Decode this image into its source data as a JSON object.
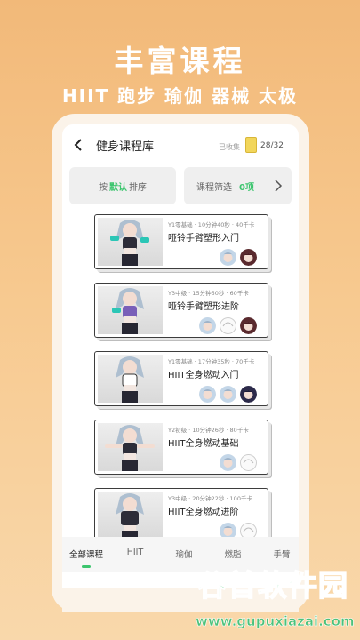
{
  "promo": {
    "title": "丰富课程",
    "subtitle": "HIIT 跑步 瑜伽 器械 太极"
  },
  "header": {
    "title": "健身课程库",
    "collected_label": "已收集",
    "count": "28/32"
  },
  "filters": {
    "sort_prefix": "按",
    "sort_value": "默认",
    "sort_suffix": "排序",
    "filter_label": "课程筛选",
    "filter_count": "0项"
  },
  "courses": [
    {
      "meta": "Y1零基础 · 10分钟40秒 · 40千卡",
      "name": "哑铃手臂塑形入门"
    },
    {
      "meta": "Y3中级 · 15分钟50秒 · 60千卡",
      "name": "哑铃手臂塑形进阶"
    },
    {
      "meta": "Y1零基础 · 17分钟35秒 · 70千卡",
      "name": "HIIT全身燃动入门"
    },
    {
      "meta": "Y2初级 · 10分钟26秒 · 80千卡",
      "name": "HIIT全身燃动基础"
    },
    {
      "meta": "Y3中级 · 20分钟22秒 · 100千卡",
      "name": "HIIT全身燃动进阶"
    }
  ],
  "tabs": [
    "全部课程",
    "HIIT",
    "瑜伽",
    "燃脂",
    "手臂"
  ],
  "active_tab": "全部课程",
  "watermark": {
    "name": "谷普软件园",
    "url": "www.gupuxiazai.com"
  },
  "colors": {
    "accent": "#3cc56e",
    "background_top": "#f2b979",
    "background_bottom": "#f9d8ab"
  }
}
